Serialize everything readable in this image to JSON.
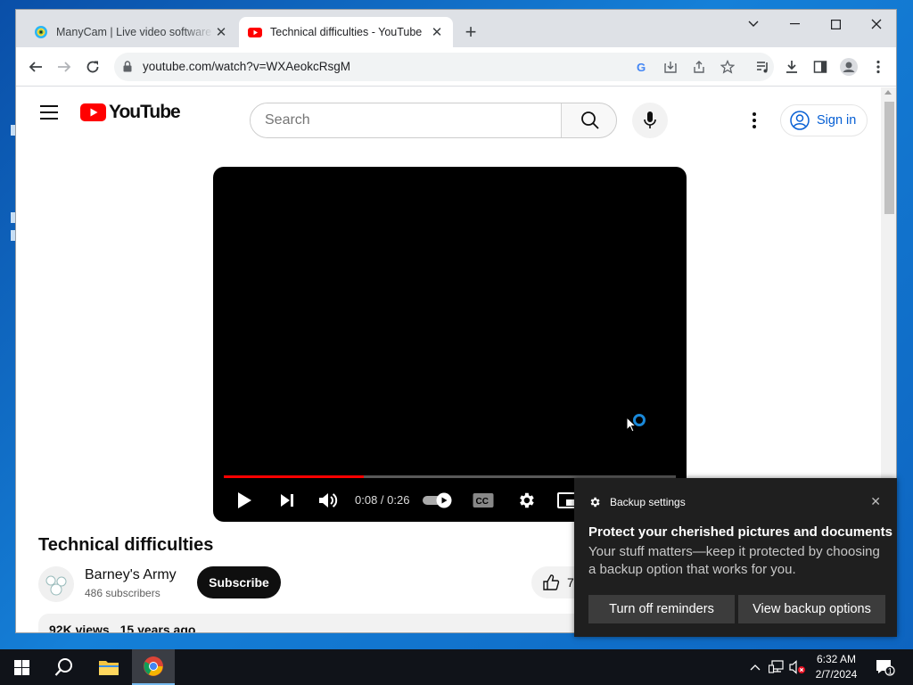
{
  "browser": {
    "tabs": [
      {
        "title": "ManyCam | Live video software &",
        "active": false
      },
      {
        "title": "Technical difficulties - YouTube",
        "active": true
      }
    ],
    "url": "youtube.com/watch?v=WXAeokcRsgM"
  },
  "youtube": {
    "logo_text": "YouTube",
    "search_placeholder": "Search",
    "sign_in": "Sign in",
    "player": {
      "current_time": "0:08",
      "duration": "0:26",
      "time_display": "0:08 / 0:26",
      "progress_fraction": 0.31
    },
    "video_title": "Technical difficulties",
    "channel_name": "Barney's Army",
    "subscribers": "486 subscribers",
    "subscribe_label": "Subscribe",
    "likes": "7",
    "views": "92K views",
    "published": "15 years ago"
  },
  "notification": {
    "app": "Backup settings",
    "headline": "Protect your cherished pictures and documents",
    "body": "Your stuff matters—keep it protected by choosing a backup option that works for you.",
    "button1": "Turn off reminders",
    "button2": "View backup options"
  },
  "taskbar": {
    "time": "6:32 AM",
    "date": "2/7/2024",
    "notification_count": "1"
  },
  "colors": {
    "youtube_red": "#ff0000",
    "link_blue": "#065fd4",
    "taskbar": "#101319",
    "toast_bg": "#1f1f1f"
  }
}
